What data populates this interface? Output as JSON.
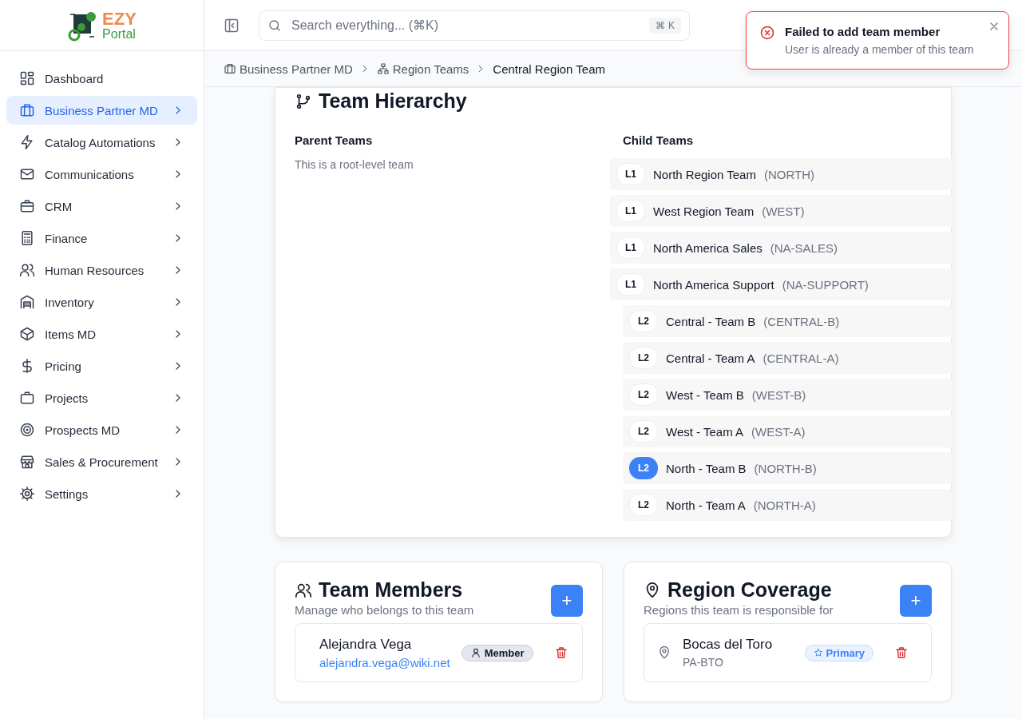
{
  "logo": {
    "word_1": "EZY",
    "word_2": "Portal"
  },
  "sidebar": {
    "items": [
      {
        "label": "Dashboard",
        "selected": false,
        "expandable": false
      },
      {
        "label": "Business Partner MD",
        "selected": true,
        "expandable": true
      },
      {
        "label": "Catalog Automations",
        "selected": false,
        "expandable": true
      },
      {
        "label": "Communications",
        "selected": false,
        "expandable": true
      },
      {
        "label": "CRM",
        "selected": false,
        "expandable": true
      },
      {
        "label": "Finance",
        "selected": false,
        "expandable": true
      },
      {
        "label": "Human Resources",
        "selected": false,
        "expandable": true
      },
      {
        "label": "Inventory",
        "selected": false,
        "expandable": true
      },
      {
        "label": "Items MD",
        "selected": false,
        "expandable": true
      },
      {
        "label": "Pricing",
        "selected": false,
        "expandable": true
      },
      {
        "label": "Projects",
        "selected": false,
        "expandable": true
      },
      {
        "label": "Prospects MD",
        "selected": false,
        "expandable": true
      },
      {
        "label": "Sales & Procurement",
        "selected": false,
        "expandable": true
      },
      {
        "label": "Settings",
        "selected": false,
        "expandable": true
      }
    ]
  },
  "search": {
    "placeholder": "Search everything... (⌘K)",
    "keys": [
      "⌘",
      "K"
    ]
  },
  "breadcrumb": [
    "Business Partner MD",
    "Region Teams",
    "Central Region Team"
  ],
  "toast": {
    "title": "Failed to add team member",
    "message": "User is already a member of this team"
  },
  "hierarchy": {
    "title": "Team Hierarchy",
    "parent_label": "Parent Teams",
    "parent_text": "This is a root-level team",
    "child_label": "Child Teams",
    "children": [
      {
        "badge": "L1",
        "name": "North Region Team",
        "code": "(NORTH)",
        "kind": "level-1",
        "selected": false
      },
      {
        "badge": "L1",
        "name": "West Region Team",
        "code": "(WEST)",
        "kind": "level-1",
        "selected": false
      },
      {
        "badge": "L1",
        "name": "North America Sales",
        "code": "(NA-SALES)",
        "kind": "level-1",
        "selected": false
      },
      {
        "badge": "L1",
        "name": "North America Support",
        "code": "(NA-SUPPORT)",
        "kind": "level-1",
        "selected": false
      },
      {
        "badge": "L2",
        "name": "Central - Team B",
        "code": "(CENTRAL-B)",
        "kind": "level-2",
        "selected": false
      },
      {
        "badge": "L2",
        "name": "Central - Team A",
        "code": "(CENTRAL-A)",
        "kind": "level-2",
        "selected": false
      },
      {
        "badge": "L2",
        "name": "West - Team B",
        "code": "(WEST-B)",
        "kind": "level-2",
        "selected": false
      },
      {
        "badge": "L2",
        "name": "West - Team A",
        "code": "(WEST-A)",
        "kind": "level-2",
        "selected": false
      },
      {
        "badge": "L2",
        "name": "North - Team B",
        "code": "(NORTH-B)",
        "kind": "level-2",
        "selected": true
      },
      {
        "badge": "L2",
        "name": "North - Team A",
        "code": "(NORTH-A)",
        "kind": "level-2",
        "selected": false
      }
    ]
  },
  "members": {
    "title": "Team Members",
    "subtitle": "Manage who belongs to this team",
    "add_label": "+",
    "items": [
      {
        "name": "Alejandra Vega",
        "email": "alejandra.vega@wiki.net",
        "role": "Member"
      }
    ]
  },
  "coverage": {
    "title": "Region Coverage",
    "subtitle": "Regions this team is responsible for",
    "add_label": "+",
    "items": [
      {
        "name": "Bocas del Toro",
        "code": "PA-BTO",
        "tag": "Primary"
      }
    ]
  }
}
